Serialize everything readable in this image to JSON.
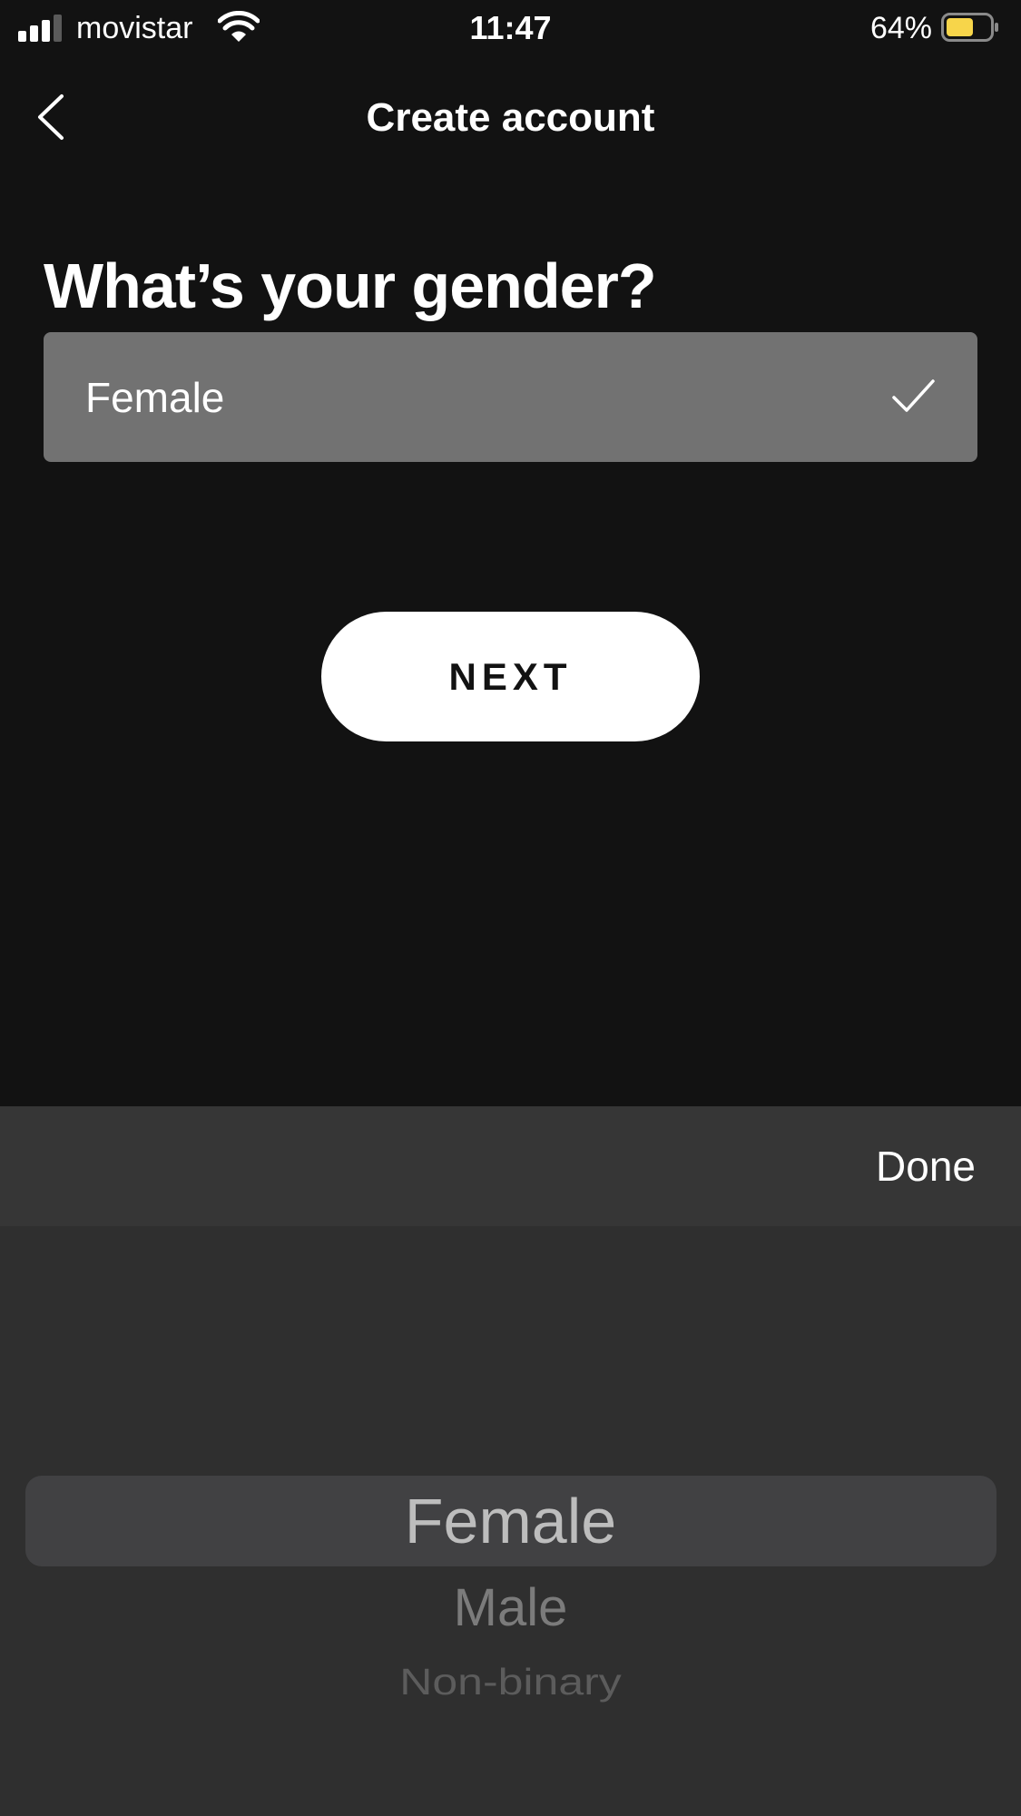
{
  "status_bar": {
    "carrier": "movistar",
    "time": "11:47",
    "battery_percent": "64%",
    "battery_level": 0.64,
    "battery_color": "#f7d54a",
    "signal_icon": "signal-bars-icon",
    "wifi_icon": "wifi-icon"
  },
  "header": {
    "title": "Create account",
    "back_icon": "chevron-left-icon"
  },
  "form": {
    "question": "What’s your gender?",
    "selected_value": "Female",
    "check_icon": "checkmark-icon",
    "field_color": "#727272"
  },
  "actions": {
    "next_label": "NEXT"
  },
  "picker": {
    "done_label": "Done",
    "options": [
      "Female",
      "Male",
      "Non-binary"
    ],
    "selected_index": 0
  },
  "colors": {
    "background": "#121212",
    "toolbar": "#363636",
    "picker_background": "#2f2f2f"
  }
}
